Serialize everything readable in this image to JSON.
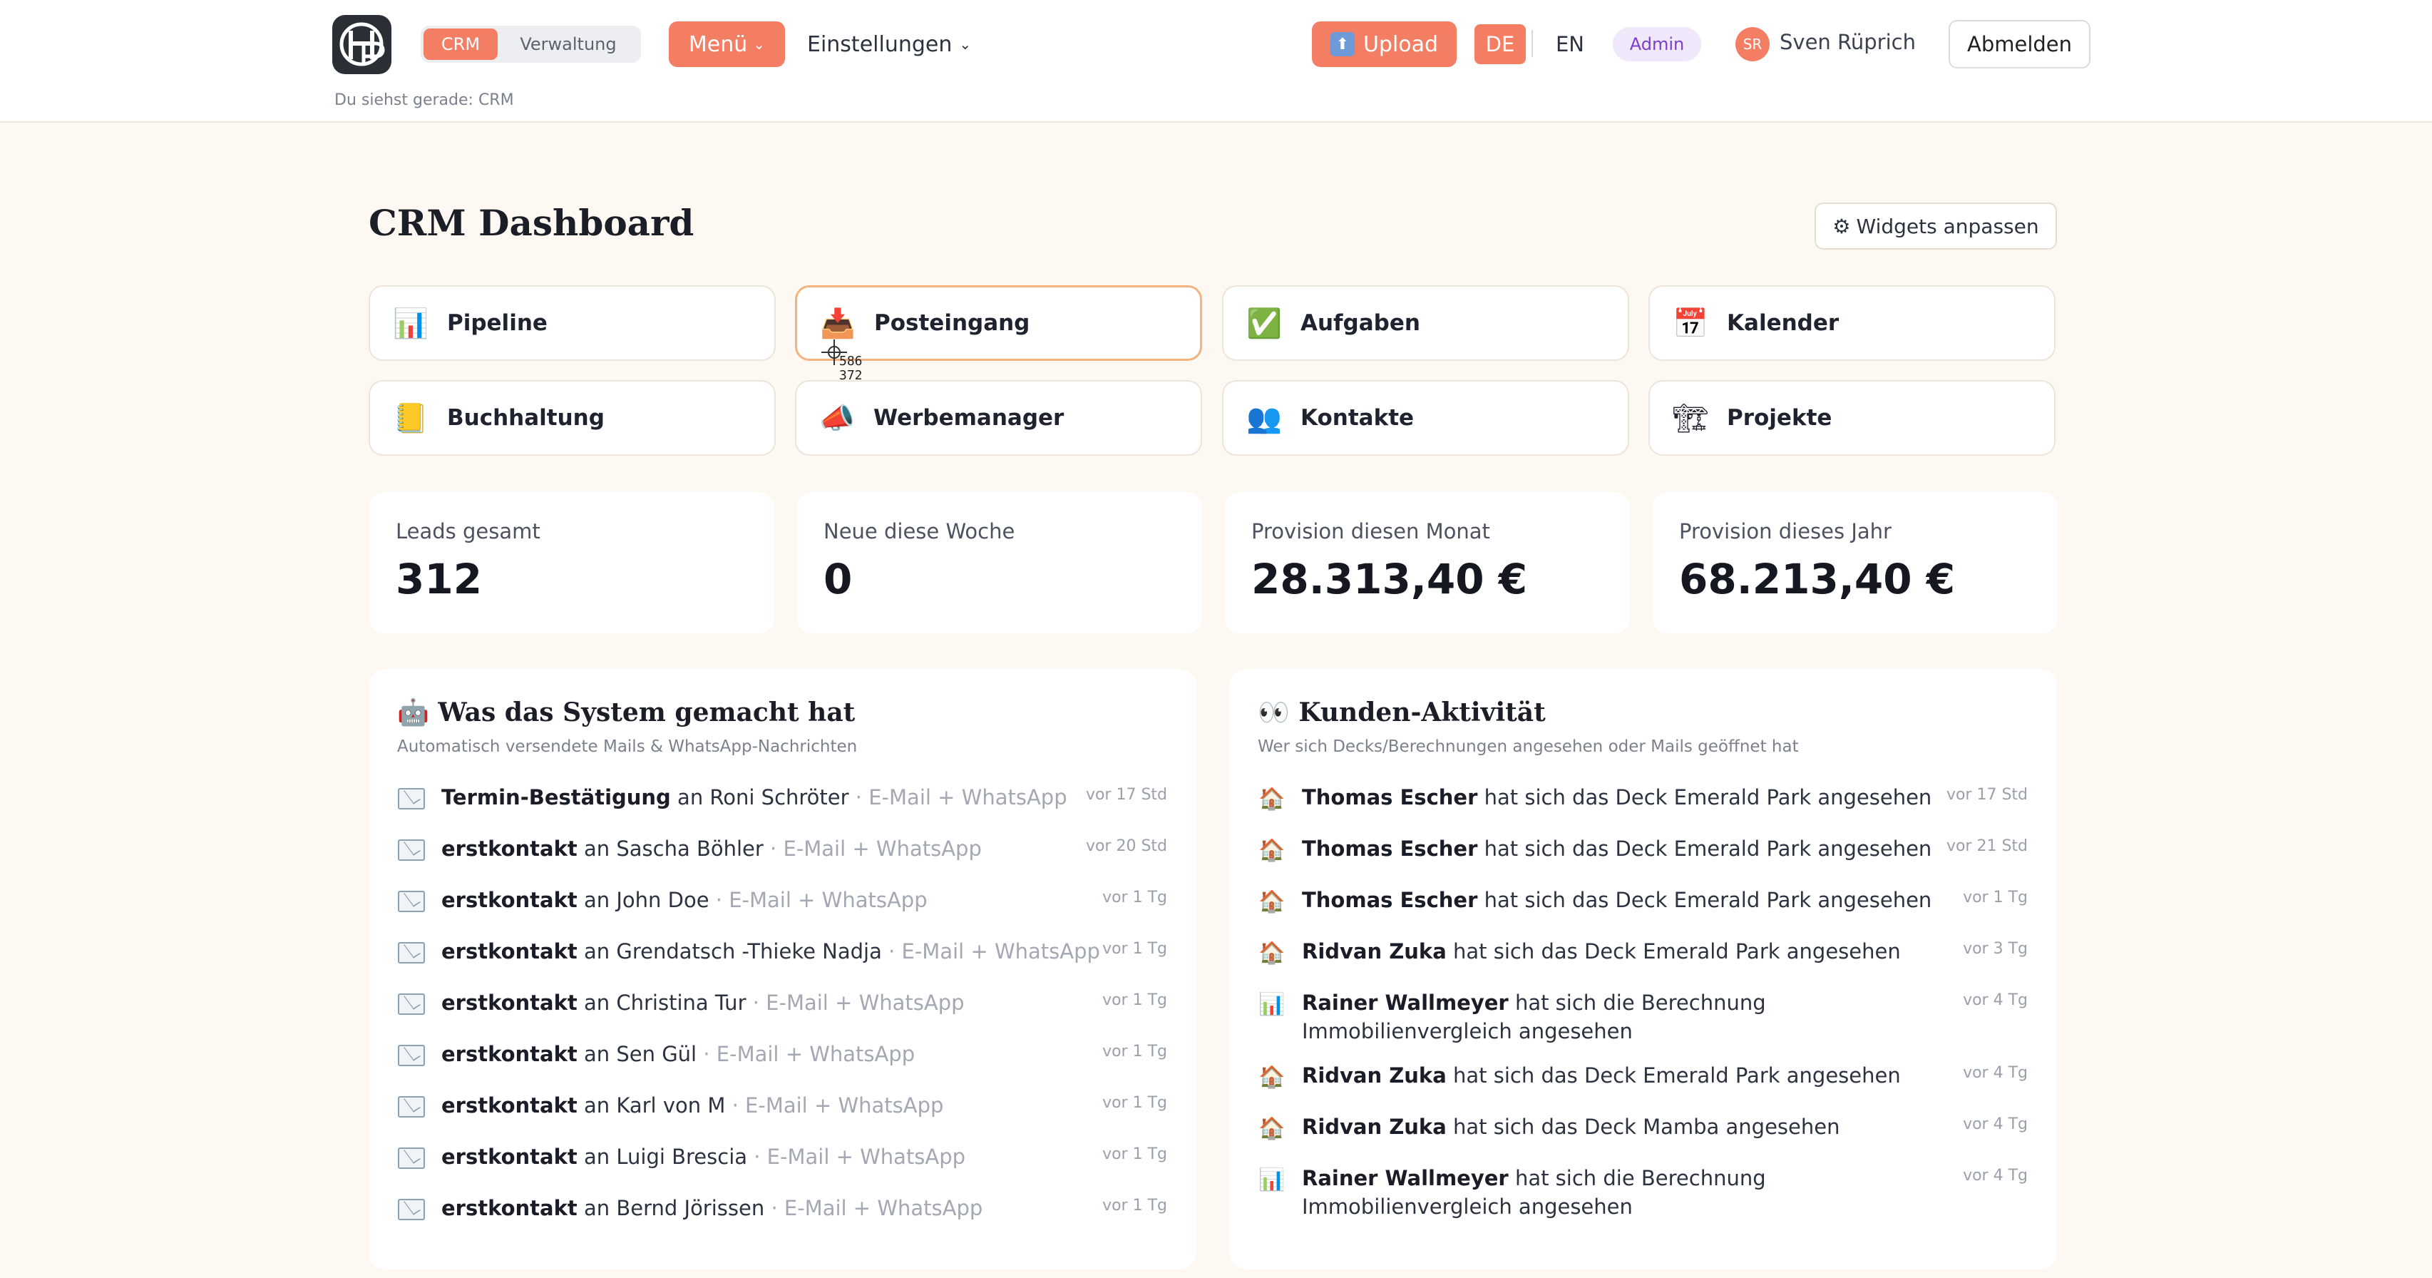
{
  "topbar": {
    "segments": [
      "CRM",
      "Verwaltung"
    ],
    "menu_label": "Menü",
    "settings_label": "Einstellungen",
    "upload_label": "Upload",
    "lang_de": "DE",
    "lang_en": "EN",
    "role_badge": "Admin",
    "avatar_initials": "SR",
    "user_name": "Sven Rüprich",
    "logout_label": "Abmelden",
    "viewing_text": "Du siehst gerade: CRM"
  },
  "header": {
    "title": "CRM Dashboard",
    "widgets_button": "Widgets anpassen",
    "widgets_icon": "⚙"
  },
  "tiles": [
    {
      "label": "Pipeline",
      "icon": "📊",
      "icon_name": "bar-chart-icon"
    },
    {
      "label": "Posteingang",
      "icon": "📥",
      "icon_name": "inbox-icon",
      "active": true
    },
    {
      "label": "Aufgaben",
      "icon": "✅",
      "icon_name": "check-icon"
    },
    {
      "label": "Kalender",
      "icon": "📅",
      "icon_name": "calendar-icon"
    },
    {
      "label": "Buchhaltung",
      "icon": "📒",
      "icon_name": "ledger-icon"
    },
    {
      "label": "Werbemanager",
      "icon": "📣",
      "icon_name": "megaphone-icon"
    },
    {
      "label": "Kontakte",
      "icon": "👥",
      "icon_name": "contacts-icon"
    },
    {
      "label": "Projekte",
      "icon": "🏗",
      "icon_name": "construction-icon"
    }
  ],
  "cursor_readout": {
    "x": "586",
    "y": "372"
  },
  "stats": [
    {
      "label": "Leads gesamt",
      "value": "312"
    },
    {
      "label": "Neue diese Woche",
      "value": "0"
    },
    {
      "label": "Provision diesen Monat",
      "value": "28.313,40 €"
    },
    {
      "label": "Provision dieses Jahr",
      "value": "68.213,40 €"
    }
  ],
  "system_panel": {
    "title": "🤖 Was das System gemacht hat",
    "subtitle": "Automatisch versendete Mails & WhatsApp-Nachrichten",
    "items": [
      {
        "template": "Termin-Bestätigung",
        "connector": "an",
        "recipient": "Roni Schröter",
        "channel": "· E-Mail + WhatsApp",
        "time": "vor 17 Std"
      },
      {
        "template": "erstkontakt",
        "connector": "an",
        "recipient": "Sascha Böhler",
        "channel": "· E-Mail + WhatsApp",
        "time": "vor 20 Std"
      },
      {
        "template": "erstkontakt",
        "connector": "an",
        "recipient": "John Doe",
        "channel": "· E-Mail + WhatsApp",
        "time": "vor 1 Tg"
      },
      {
        "template": "erstkontakt",
        "connector": "an",
        "recipient": "Grendatsch -Thieke Nadja",
        "channel": "· E-Mail + WhatsApp",
        "time": "vor 1 Tg"
      },
      {
        "template": "erstkontakt",
        "connector": "an",
        "recipient": "Christina Tur",
        "channel": "· E-Mail + WhatsApp",
        "time": "vor 1 Tg"
      },
      {
        "template": "erstkontakt",
        "connector": "an",
        "recipient": "Sen Gül",
        "channel": "· E-Mail + WhatsApp",
        "time": "vor 1 Tg"
      },
      {
        "template": "erstkontakt",
        "connector": "an",
        "recipient": "Karl von M",
        "channel": "· E-Mail + WhatsApp",
        "time": "vor 1 Tg"
      },
      {
        "template": "erstkontakt",
        "connector": "an",
        "recipient": "Luigi Brescia",
        "channel": "· E-Mail + WhatsApp",
        "time": "vor 1 Tg"
      },
      {
        "template": "erstkontakt",
        "connector": "an",
        "recipient": "Bernd Jörissen",
        "channel": "· E-Mail + WhatsApp",
        "time": "vor 1 Tg"
      }
    ]
  },
  "activity_panel": {
    "title": "👀 Kunden-Aktivität",
    "subtitle": "Wer sich Decks/Berechnungen angesehen oder Mails geöffnet hat",
    "items": [
      {
        "icon": "🏠",
        "icon_name": "house-icon",
        "name": "Thomas Escher",
        "action": "hat sich das Deck Emerald Park angesehen",
        "time": "vor 17 Std"
      },
      {
        "icon": "🏠",
        "icon_name": "house-icon",
        "name": "Thomas Escher",
        "action": "hat sich das Deck Emerald Park angesehen",
        "time": "vor 21 Std"
      },
      {
        "icon": "🏠",
        "icon_name": "house-icon",
        "name": "Thomas Escher",
        "action": "hat sich das Deck Emerald Park angesehen",
        "time": "vor 1 Tg"
      },
      {
        "icon": "🏠",
        "icon_name": "house-icon",
        "name": "Ridvan Zuka",
        "action": "hat sich das Deck Emerald Park angesehen",
        "time": "vor 3 Tg"
      },
      {
        "icon": "📊",
        "icon_name": "bar-chart-icon",
        "name": "Rainer Wallmeyer",
        "action": "hat sich die Berechnung",
        "action2": "Immobilienvergleich angesehen",
        "time": "vor 4 Tg"
      },
      {
        "icon": "🏠",
        "icon_name": "house-icon",
        "name": "Ridvan Zuka",
        "action": "hat sich das Deck Emerald Park angesehen",
        "time": "vor 4 Tg"
      },
      {
        "icon": "🏠",
        "icon_name": "house-icon",
        "name": "Ridvan Zuka",
        "action": "hat sich das Deck Mamba angesehen",
        "time": "vor 4 Tg"
      },
      {
        "icon": "📊",
        "icon_name": "bar-chart-icon",
        "name": "Rainer Wallmeyer",
        "action": "hat sich die Berechnung",
        "action2": "Immobilienvergleich angesehen",
        "time": "vor 4 Tg"
      }
    ]
  },
  "colors": {
    "accent": "#f47e64",
    "background": "#fdf9f2",
    "admin": "#7c3ec9"
  }
}
